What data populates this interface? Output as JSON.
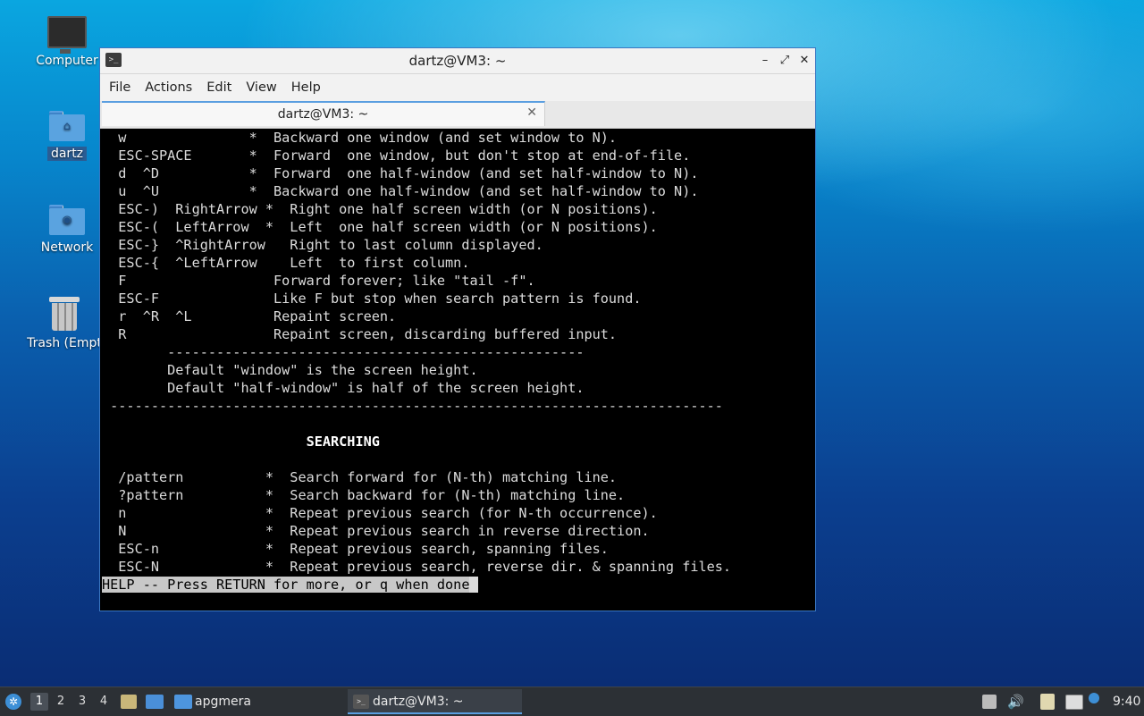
{
  "desktop": {
    "icons": [
      {
        "label": "Computer"
      },
      {
        "label": "dartz"
      },
      {
        "label": "Network"
      },
      {
        "label": "Trash (Empt"
      }
    ]
  },
  "window": {
    "title": "dartz@VM3: ~",
    "menu": [
      "File",
      "Actions",
      "Edit",
      "View",
      "Help"
    ],
    "tab_label": "dartz@VM3: ~"
  },
  "terminal": {
    "lines": [
      "  w               *  Backward one window (and set window to N).",
      "  ESC-SPACE       *  Forward  one window, but don't stop at end-of-file.",
      "  d  ^D           *  Forward  one half-window (and set half-window to N).",
      "  u  ^U           *  Backward one half-window (and set half-window to N).",
      "  ESC-)  RightArrow *  Right one half screen width (or N positions).",
      "  ESC-(  LeftArrow  *  Left  one half screen width (or N positions).",
      "  ESC-}  ^RightArrow   Right to last column displayed.",
      "  ESC-{  ^LeftArrow    Left  to first column.",
      "  F                  Forward forever; like \"tail -f\".",
      "  ESC-F              Like F but stop when search pattern is found.",
      "  r  ^R  ^L          Repaint screen.",
      "  R                  Repaint screen, discarding buffered input.",
      "        ---------------------------------------------------",
      "        Default \"window\" is the screen height.",
      "        Default \"half-window\" is half of the screen height.",
      " ---------------------------------------------------------------------------",
      "",
      "                         SEARCHING",
      "",
      "  /pattern          *  Search forward for (N-th) matching line.",
      "  ?pattern          *  Search backward for (N-th) matching line.",
      "  n                 *  Repeat previous search (for N-th occurrence).",
      "  N                 *  Repeat previous search in reverse direction.",
      "  ESC-n             *  Repeat previous search, spanning files.",
      "  ESC-N             *  Repeat previous search, reverse dir. & spanning files."
    ],
    "prompt": "HELP -- Press RETURN for more, or q when done"
  },
  "taskbar": {
    "workspaces": [
      "1",
      "2",
      "3",
      "4"
    ],
    "folder_task": "apgmera",
    "terminal_task": "dartz@VM3: ~",
    "clock": "9:40"
  }
}
